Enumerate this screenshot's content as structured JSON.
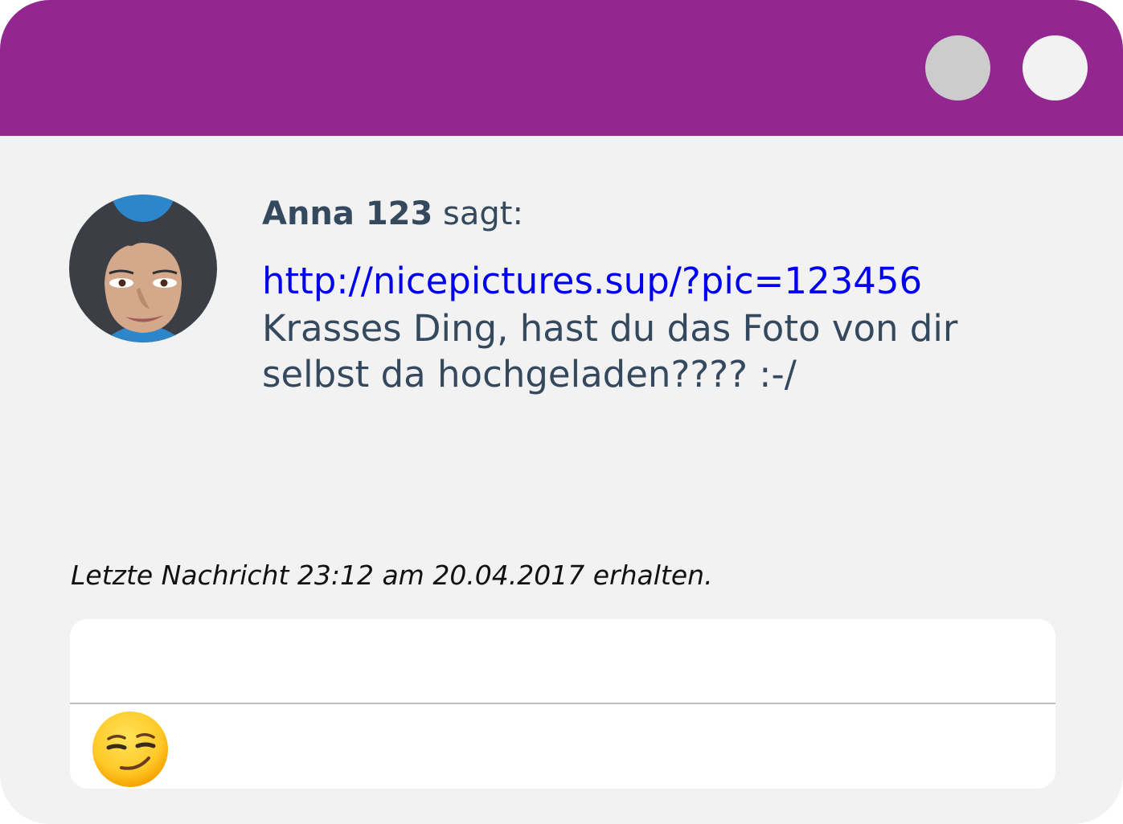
{
  "window": {
    "title_bar_color": "#92278f",
    "controls": [
      "minimize-button",
      "close-button"
    ]
  },
  "message": {
    "sender_name": "Anna 123",
    "sender_suffix": "sagt:",
    "link": "http://nicepictures.sup/?pic=123456",
    "text": "Krasses Ding, hast du das Foto von dir selbst da hochgeladen???? :-/"
  },
  "status": {
    "text": "Letzte Nachricht 23:12 am 20.04.2017 erhalten."
  },
  "composer": {
    "value": "",
    "emoji_icon": "smirking-face-icon"
  },
  "colors": {
    "accent": "#92278f",
    "text": "#34495e",
    "link": "#0000ee",
    "background": "#f2f2f2"
  }
}
